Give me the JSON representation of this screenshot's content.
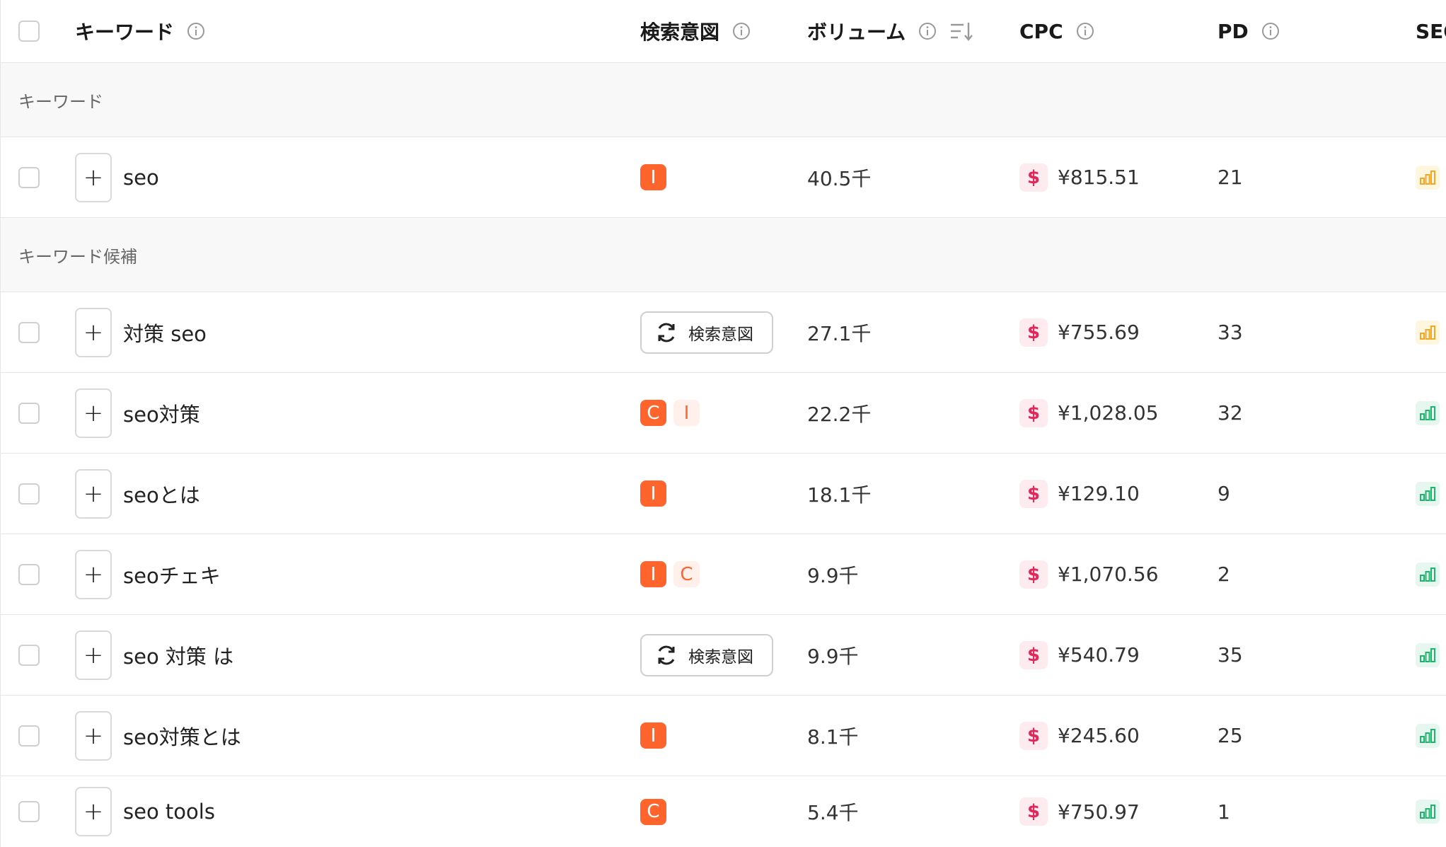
{
  "header": {
    "keyword": "キーワード",
    "intent": "検索意図",
    "volume": "ボリューム",
    "cpc": "CPC",
    "pd": "PD",
    "seo": "SEO"
  },
  "groups": {
    "keyword": "キーワード",
    "candidates": "キーワード候補"
  },
  "intent_button_label": "検索意図",
  "cpc_icon_glyph": "$",
  "add_glyph": "+",
  "colors": {
    "intent_badge": "#ff642d",
    "cpc_icon": "#e0285a",
    "seo_orange": "#f5a623",
    "seo_green": "#1fb56f"
  },
  "rows": [
    {
      "keyword": "seo",
      "intents": [
        {
          "letter": "I",
          "style": "strong"
        }
      ],
      "volume": "40.5千",
      "cpc": "¥815.51",
      "pd": "21",
      "seo_level": "orange"
    },
    {
      "keyword": "対策 seo",
      "intents": [],
      "intent_button": true,
      "volume": "27.1千",
      "cpc": "¥755.69",
      "pd": "33",
      "seo_level": "orange"
    },
    {
      "keyword": "seo対策",
      "intents": [
        {
          "letter": "C",
          "style": "strong"
        },
        {
          "letter": "I",
          "style": "light"
        }
      ],
      "volume": "22.2千",
      "cpc": "¥1,028.05",
      "pd": "32",
      "seo_level": "green"
    },
    {
      "keyword": "seoとは",
      "intents": [
        {
          "letter": "I",
          "style": "strong"
        }
      ],
      "volume": "18.1千",
      "cpc": "¥129.10",
      "pd": "9",
      "seo_level": "green"
    },
    {
      "keyword": "seoチェキ",
      "intents": [
        {
          "letter": "I",
          "style": "strong"
        },
        {
          "letter": "C",
          "style": "light"
        }
      ],
      "volume": "9.9千",
      "cpc": "¥1,070.56",
      "pd": "2",
      "seo_level": "green"
    },
    {
      "keyword": "seo 対策 は",
      "intents": [],
      "intent_button": true,
      "volume": "9.9千",
      "cpc": "¥540.79",
      "pd": "35",
      "seo_level": "green"
    },
    {
      "keyword": "seo対策とは",
      "intents": [
        {
          "letter": "I",
          "style": "strong"
        }
      ],
      "volume": "8.1千",
      "cpc": "¥245.60",
      "pd": "25",
      "seo_level": "green"
    },
    {
      "keyword": "seo tools",
      "intents": [
        {
          "letter": "C",
          "style": "strong"
        }
      ],
      "volume": "5.4千",
      "cpc": "¥750.97",
      "pd": "1",
      "seo_level": "green"
    }
  ]
}
